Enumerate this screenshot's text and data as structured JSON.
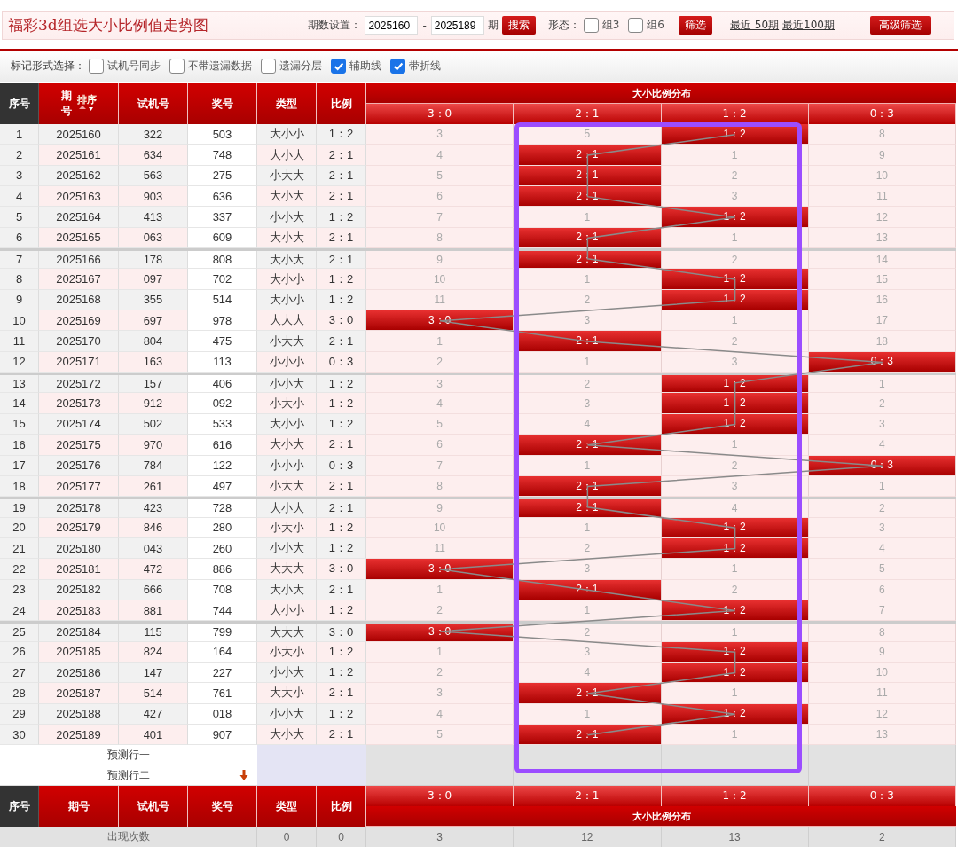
{
  "title": "福彩3d组选大小比例值走势图",
  "period_filter": {
    "label": "期数设置：",
    "from": "2025160",
    "separator": "-",
    "to": "2025189",
    "unit": "期"
  },
  "search_button": "搜索",
  "form_filter": {
    "label": "形态：",
    "options": [
      {
        "label": "组3",
        "checked": false
      },
      {
        "label": "组6",
        "checked": false
      }
    ]
  },
  "filter_button": "筛选",
  "quick_links": [
    "最近 50期",
    "最近100期"
  ],
  "advanced_button": "高级筛选",
  "mark_options": {
    "label": "标记形式选择：",
    "options": [
      {
        "label": "试机号同步",
        "checked": false
      },
      {
        "label": "不带遗漏数据",
        "checked": false
      },
      {
        "label": "遗漏分层",
        "checked": false
      },
      {
        "label": "辅助线",
        "checked": true
      },
      {
        "label": "带折线",
        "checked": true
      }
    ]
  },
  "table": {
    "columns": [
      "序号",
      "期号",
      "试机号",
      "奖号",
      "类型",
      "比例"
    ],
    "sort_label": "排序",
    "group_title": "大小比例分布",
    "ratios": [
      "3：0",
      "2：1",
      "1：2",
      "0：3"
    ],
    "rows": [
      {
        "no": "1",
        "issue": "2025160",
        "trial": "322",
        "prize": "503",
        "type": "大小小",
        "ratio": "1：2",
        "cells": [
          {
            "v": "3",
            "hit": false
          },
          {
            "v": "5",
            "hit": false
          },
          {
            "v": "1：2",
            "hit": true
          },
          {
            "v": "8",
            "hit": false
          }
        ]
      },
      {
        "no": "2",
        "issue": "2025161",
        "trial": "634",
        "prize": "748",
        "type": "大小大",
        "ratio": "2：1",
        "cells": [
          {
            "v": "4",
            "hit": false
          },
          {
            "v": "2：1",
            "hit": true
          },
          {
            "v": "1",
            "hit": false
          },
          {
            "v": "9",
            "hit": false
          }
        ]
      },
      {
        "no": "3",
        "issue": "2025162",
        "trial": "563",
        "prize": "275",
        "type": "小大大",
        "ratio": "2：1",
        "cells": [
          {
            "v": "5",
            "hit": false
          },
          {
            "v": "2：1",
            "hit": true
          },
          {
            "v": "2",
            "hit": false
          },
          {
            "v": "10",
            "hit": false
          }
        ]
      },
      {
        "no": "4",
        "issue": "2025163",
        "trial": "903",
        "prize": "636",
        "type": "大小大",
        "ratio": "2：1",
        "cells": [
          {
            "v": "6",
            "hit": false
          },
          {
            "v": "2：1",
            "hit": true
          },
          {
            "v": "3",
            "hit": false
          },
          {
            "v": "11",
            "hit": false
          }
        ]
      },
      {
        "no": "5",
        "issue": "2025164",
        "trial": "413",
        "prize": "337",
        "type": "小小大",
        "ratio": "1：2",
        "cells": [
          {
            "v": "7",
            "hit": false
          },
          {
            "v": "1",
            "hit": false
          },
          {
            "v": "1：2",
            "hit": true
          },
          {
            "v": "12",
            "hit": false
          }
        ]
      },
      {
        "no": "6",
        "issue": "2025165",
        "trial": "063",
        "prize": "609",
        "type": "大小大",
        "ratio": "2：1",
        "cells": [
          {
            "v": "8",
            "hit": false
          },
          {
            "v": "2：1",
            "hit": true
          },
          {
            "v": "1",
            "hit": false
          },
          {
            "v": "13",
            "hit": false
          }
        ]
      },
      {
        "no": "7",
        "issue": "2025166",
        "trial": "178",
        "prize": "808",
        "type": "大小大",
        "ratio": "2：1",
        "cells": [
          {
            "v": "9",
            "hit": false
          },
          {
            "v": "2：1",
            "hit": true
          },
          {
            "v": "2",
            "hit": false
          },
          {
            "v": "14",
            "hit": false
          }
        ]
      },
      {
        "no": "8",
        "issue": "2025167",
        "trial": "097",
        "prize": "702",
        "type": "大小小",
        "ratio": "1：2",
        "cells": [
          {
            "v": "10",
            "hit": false
          },
          {
            "v": "1",
            "hit": false
          },
          {
            "v": "1：2",
            "hit": true
          },
          {
            "v": "15",
            "hit": false
          }
        ]
      },
      {
        "no": "9",
        "issue": "2025168",
        "trial": "355",
        "prize": "514",
        "type": "大小小",
        "ratio": "1：2",
        "cells": [
          {
            "v": "11",
            "hit": false
          },
          {
            "v": "2",
            "hit": false
          },
          {
            "v": "1：2",
            "hit": true
          },
          {
            "v": "16",
            "hit": false
          }
        ]
      },
      {
        "no": "10",
        "issue": "2025169",
        "trial": "697",
        "prize": "978",
        "type": "大大大",
        "ratio": "3：0",
        "cells": [
          {
            "v": "3：0",
            "hit": true
          },
          {
            "v": "3",
            "hit": false
          },
          {
            "v": "1",
            "hit": false
          },
          {
            "v": "17",
            "hit": false
          }
        ]
      },
      {
        "no": "11",
        "issue": "2025170",
        "trial": "804",
        "prize": "475",
        "type": "小大大",
        "ratio": "2：1",
        "cells": [
          {
            "v": "1",
            "hit": false
          },
          {
            "v": "2：1",
            "hit": true
          },
          {
            "v": "2",
            "hit": false
          },
          {
            "v": "18",
            "hit": false
          }
        ]
      },
      {
        "no": "12",
        "issue": "2025171",
        "trial": "163",
        "prize": "113",
        "type": "小小小",
        "ratio": "0：3",
        "cells": [
          {
            "v": "2",
            "hit": false
          },
          {
            "v": "1",
            "hit": false
          },
          {
            "v": "3",
            "hit": false
          },
          {
            "v": "0：3",
            "hit": true
          }
        ]
      },
      {
        "no": "13",
        "issue": "2025172",
        "trial": "157",
        "prize": "406",
        "type": "小小大",
        "ratio": "1：2",
        "cells": [
          {
            "v": "3",
            "hit": false
          },
          {
            "v": "2",
            "hit": false
          },
          {
            "v": "1：2",
            "hit": true
          },
          {
            "v": "1",
            "hit": false
          }
        ]
      },
      {
        "no": "14",
        "issue": "2025173",
        "trial": "912",
        "prize": "092",
        "type": "小大小",
        "ratio": "1：2",
        "cells": [
          {
            "v": "4",
            "hit": false
          },
          {
            "v": "3",
            "hit": false
          },
          {
            "v": "1：2",
            "hit": true
          },
          {
            "v": "2",
            "hit": false
          }
        ]
      },
      {
        "no": "15",
        "issue": "2025174",
        "trial": "502",
        "prize": "533",
        "type": "大小小",
        "ratio": "1：2",
        "cells": [
          {
            "v": "5",
            "hit": false
          },
          {
            "v": "4",
            "hit": false
          },
          {
            "v": "1：2",
            "hit": true
          },
          {
            "v": "3",
            "hit": false
          }
        ]
      },
      {
        "no": "16",
        "issue": "2025175",
        "trial": "970",
        "prize": "616",
        "type": "大小大",
        "ratio": "2：1",
        "cells": [
          {
            "v": "6",
            "hit": false
          },
          {
            "v": "2：1",
            "hit": true
          },
          {
            "v": "1",
            "hit": false
          },
          {
            "v": "4",
            "hit": false
          }
        ]
      },
      {
        "no": "17",
        "issue": "2025176",
        "trial": "784",
        "prize": "122",
        "type": "小小小",
        "ratio": "0：3",
        "cells": [
          {
            "v": "7",
            "hit": false
          },
          {
            "v": "1",
            "hit": false
          },
          {
            "v": "2",
            "hit": false
          },
          {
            "v": "0：3",
            "hit": true
          }
        ]
      },
      {
        "no": "18",
        "issue": "2025177",
        "trial": "261",
        "prize": "497",
        "type": "小大大",
        "ratio": "2：1",
        "cells": [
          {
            "v": "8",
            "hit": false
          },
          {
            "v": "2：1",
            "hit": true
          },
          {
            "v": "3",
            "hit": false
          },
          {
            "v": "1",
            "hit": false
          }
        ]
      },
      {
        "no": "19",
        "issue": "2025178",
        "trial": "423",
        "prize": "728",
        "type": "大小大",
        "ratio": "2：1",
        "cells": [
          {
            "v": "9",
            "hit": false
          },
          {
            "v": "2：1",
            "hit": true
          },
          {
            "v": "4",
            "hit": false
          },
          {
            "v": "2",
            "hit": false
          }
        ]
      },
      {
        "no": "20",
        "issue": "2025179",
        "trial": "846",
        "prize": "280",
        "type": "小大小",
        "ratio": "1：2",
        "cells": [
          {
            "v": "10",
            "hit": false
          },
          {
            "v": "1",
            "hit": false
          },
          {
            "v": "1：2",
            "hit": true
          },
          {
            "v": "3",
            "hit": false
          }
        ]
      },
      {
        "no": "21",
        "issue": "2025180",
        "trial": "043",
        "prize": "260",
        "type": "小小大",
        "ratio": "1：2",
        "cells": [
          {
            "v": "11",
            "hit": false
          },
          {
            "v": "2",
            "hit": false
          },
          {
            "v": "1：2",
            "hit": true
          },
          {
            "v": "4",
            "hit": false
          }
        ]
      },
      {
        "no": "22",
        "issue": "2025181",
        "trial": "472",
        "prize": "886",
        "type": "大大大",
        "ratio": "3：0",
        "cells": [
          {
            "v": "3：0",
            "hit": true
          },
          {
            "v": "3",
            "hit": false
          },
          {
            "v": "1",
            "hit": false
          },
          {
            "v": "5",
            "hit": false
          }
        ]
      },
      {
        "no": "23",
        "issue": "2025182",
        "trial": "666",
        "prize": "708",
        "type": "大小大",
        "ratio": "2：1",
        "cells": [
          {
            "v": "1",
            "hit": false
          },
          {
            "v": "2：1",
            "hit": true
          },
          {
            "v": "2",
            "hit": false
          },
          {
            "v": "6",
            "hit": false
          }
        ]
      },
      {
        "no": "24",
        "issue": "2025183",
        "trial": "881",
        "prize": "744",
        "type": "大小小",
        "ratio": "1：2",
        "cells": [
          {
            "v": "2",
            "hit": false
          },
          {
            "v": "1",
            "hit": false
          },
          {
            "v": "1：2",
            "hit": true
          },
          {
            "v": "7",
            "hit": false
          }
        ]
      },
      {
        "no": "25",
        "issue": "2025184",
        "trial": "115",
        "prize": "799",
        "type": "大大大",
        "ratio": "3：0",
        "cells": [
          {
            "v": "3：0",
            "hit": true
          },
          {
            "v": "2",
            "hit": false
          },
          {
            "v": "1",
            "hit": false
          },
          {
            "v": "8",
            "hit": false
          }
        ]
      },
      {
        "no": "26",
        "issue": "2025185",
        "trial": "824",
        "prize": "164",
        "type": "小大小",
        "ratio": "1：2",
        "cells": [
          {
            "v": "1",
            "hit": false
          },
          {
            "v": "3",
            "hit": false
          },
          {
            "v": "1：2",
            "hit": true
          },
          {
            "v": "9",
            "hit": false
          }
        ]
      },
      {
        "no": "27",
        "issue": "2025186",
        "trial": "147",
        "prize": "227",
        "type": "小小大",
        "ratio": "1：2",
        "cells": [
          {
            "v": "2",
            "hit": false
          },
          {
            "v": "4",
            "hit": false
          },
          {
            "v": "1：2",
            "hit": true
          },
          {
            "v": "10",
            "hit": false
          }
        ]
      },
      {
        "no": "28",
        "issue": "2025187",
        "trial": "514",
        "prize": "761",
        "type": "大大小",
        "ratio": "2：1",
        "cells": [
          {
            "v": "3",
            "hit": false
          },
          {
            "v": "2：1",
            "hit": true
          },
          {
            "v": "1",
            "hit": false
          },
          {
            "v": "11",
            "hit": false
          }
        ]
      },
      {
        "no": "29",
        "issue": "2025188",
        "trial": "427",
        "prize": "018",
        "type": "小小大",
        "ratio": "1：2",
        "cells": [
          {
            "v": "4",
            "hit": false
          },
          {
            "v": "1",
            "hit": false
          },
          {
            "v": "1：2",
            "hit": true
          },
          {
            "v": "12",
            "hit": false
          }
        ]
      },
      {
        "no": "30",
        "issue": "2025189",
        "trial": "401",
        "prize": "907",
        "type": "大小大",
        "ratio": "2：1",
        "cells": [
          {
            "v": "5",
            "hit": false
          },
          {
            "v": "2：1",
            "hit": true
          },
          {
            "v": "1",
            "hit": false
          },
          {
            "v": "13",
            "hit": false
          }
        ]
      }
    ],
    "forecast_rows": [
      "预测行一",
      "预测行二"
    ],
    "footer_columns": [
      "序号",
      "期号",
      "试机号",
      "奖号",
      "类型",
      "比例"
    ],
    "footer_ratios": [
      "3：0",
      "2：1",
      "1：2",
      "0：3"
    ],
    "footer_group_title": "大小比例分布",
    "totals": {
      "label": "出现次数",
      "type": "0",
      "ratio": "0",
      "counts": [
        "3",
        "12",
        "13",
        "2"
      ]
    }
  }
}
